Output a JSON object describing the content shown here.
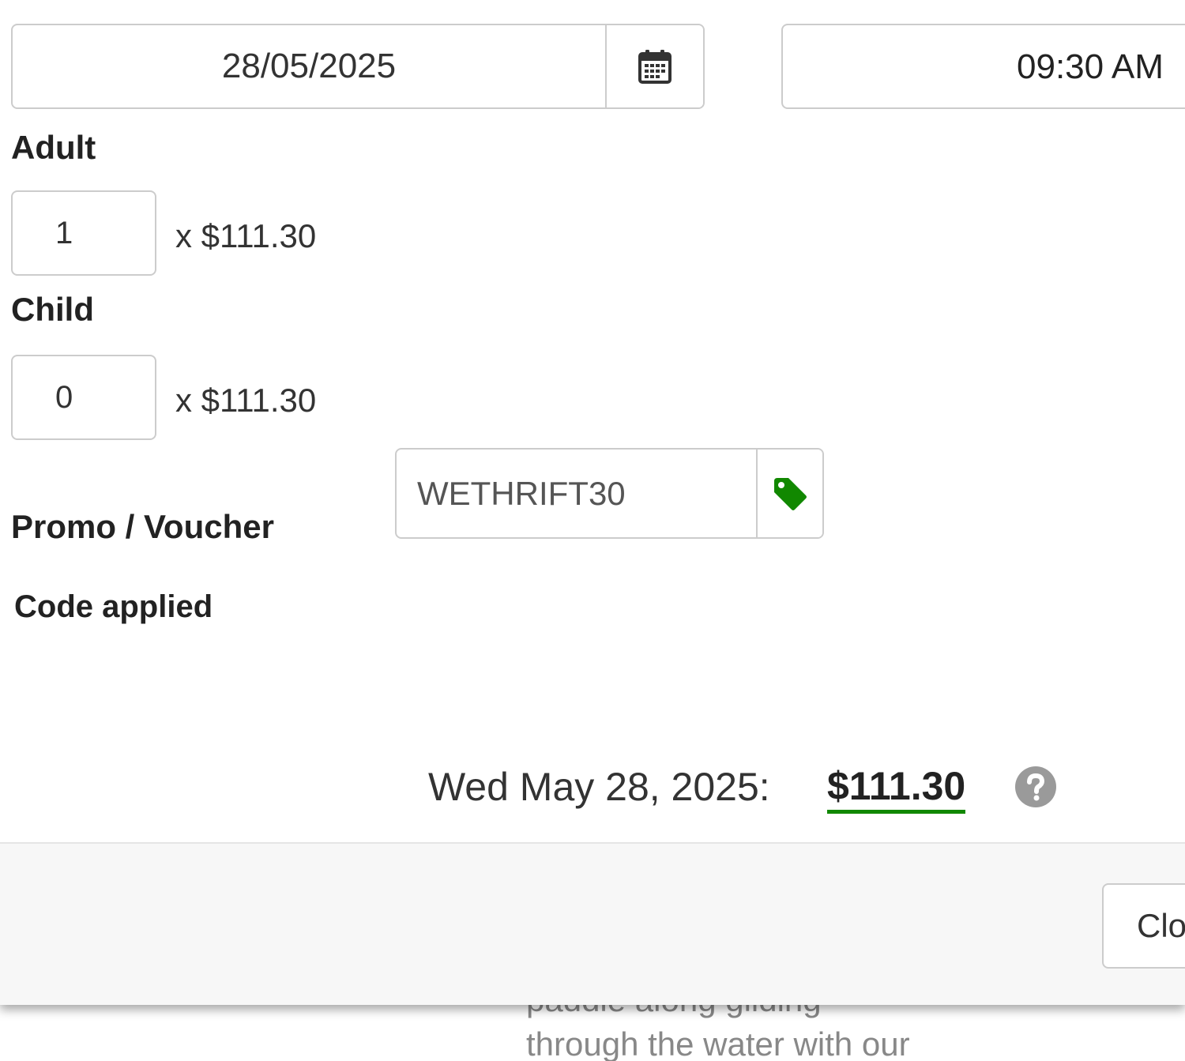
{
  "booking": {
    "date_value": "28/05/2025",
    "time_value": "09:30 AM",
    "adult": {
      "label": "Adult",
      "quantity": "1",
      "price": "x $111.30"
    },
    "child": {
      "label": "Child",
      "quantity": "0",
      "price": "x $111.30"
    },
    "promo": {
      "label": "Promo / Voucher",
      "code_value": "WETHRIFT30",
      "status": "Code applied"
    },
    "summary": {
      "date_label": "Wed May 28, 2025:",
      "total": "$111.30"
    }
  },
  "footer": {
    "close_label": "Close"
  },
  "background": {
    "partial_line": "paddle along gliding",
    "line": "through the water with our"
  },
  "icons": {
    "calendar": "calendar-icon",
    "promo_tag": "tag-icon",
    "help": "question-circle-icon"
  },
  "colors": {
    "tag_green": "#118800",
    "total_underline": "#118800",
    "help_gray": "#9a9a9a",
    "footer_bg": "#f7f7f7"
  }
}
